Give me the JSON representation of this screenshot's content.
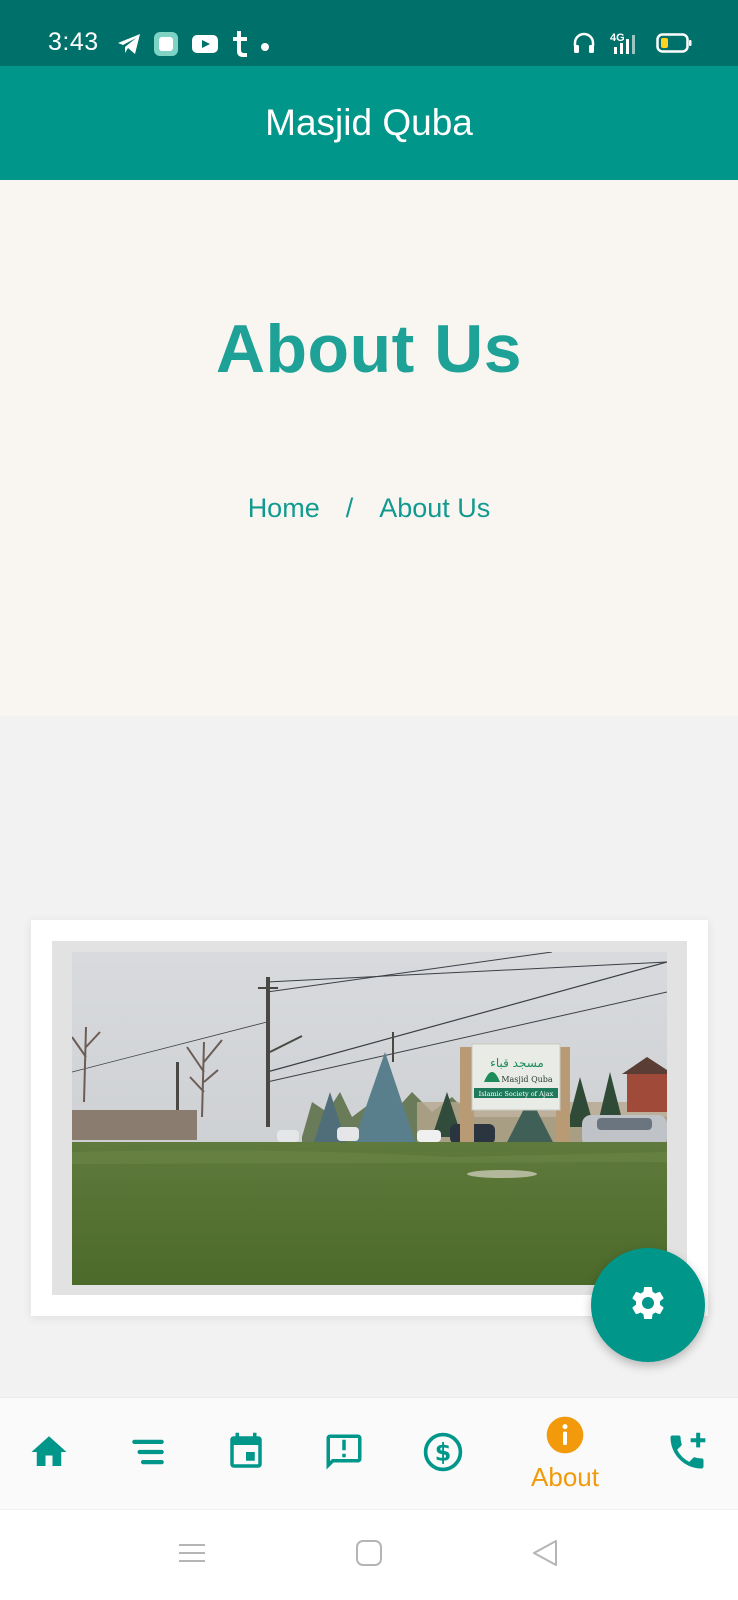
{
  "status_bar": {
    "time": "3:43",
    "left_icons": [
      "telegram-icon",
      "app-icon",
      "youtube-icon",
      "tumblr-icon",
      "notification-dot-icon"
    ],
    "right_icons": [
      "headset-icon",
      "signal-4g-icon",
      "battery-icon"
    ],
    "network": "4G"
  },
  "app_bar": {
    "title": "Masjid Quba"
  },
  "hero": {
    "title": "About Us",
    "breadcrumb": {
      "home": "Home",
      "separator": "/",
      "current": "About Us"
    }
  },
  "photo": {
    "sign_arabic": "مسجد قباء",
    "sign_line1": "Masjid Quba",
    "sign_line2": "Islamic Society of Ajax"
  },
  "fab": {
    "icon": "gear-icon"
  },
  "bottom_nav": {
    "items": [
      {
        "icon": "home-icon"
      },
      {
        "icon": "menu-icon"
      },
      {
        "icon": "calendar-icon"
      },
      {
        "icon": "announcement-icon"
      },
      {
        "icon": "donate-icon"
      },
      {
        "icon": "info-icon",
        "label": "About",
        "active": true
      },
      {
        "icon": "add-call-icon"
      }
    ]
  },
  "colors": {
    "status_bar": "#00706a",
    "primary": "#00968a",
    "accent_text": "#1ea196",
    "active_nav": "#f29a0b",
    "hero_bg": "#f9f6f1"
  }
}
